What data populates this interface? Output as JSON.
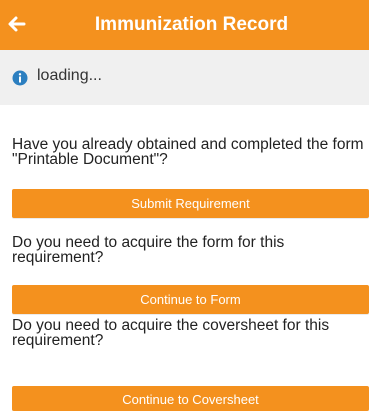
{
  "colors": {
    "accent": "#f4911e",
    "header_text": "#ffffff",
    "status_bg": "#f0f0f0",
    "info_icon": "#2c7fc0"
  },
  "header": {
    "title": "Immunization Record",
    "back_icon": "arrow-left-icon"
  },
  "status": {
    "icon": "info-circle-icon",
    "text": "loading..."
  },
  "sections": [
    {
      "question": "Have you already obtained and completed the form \"Printable Document\"?",
      "button_label": "Submit Requirement"
    },
    {
      "question": "Do you need to acquire the form for this requirement?",
      "button_label": "Continue to Form"
    },
    {
      "question": "Do you need to acquire the coversheet for this requirement?",
      "button_label": "Continue to Coversheet"
    }
  ]
}
